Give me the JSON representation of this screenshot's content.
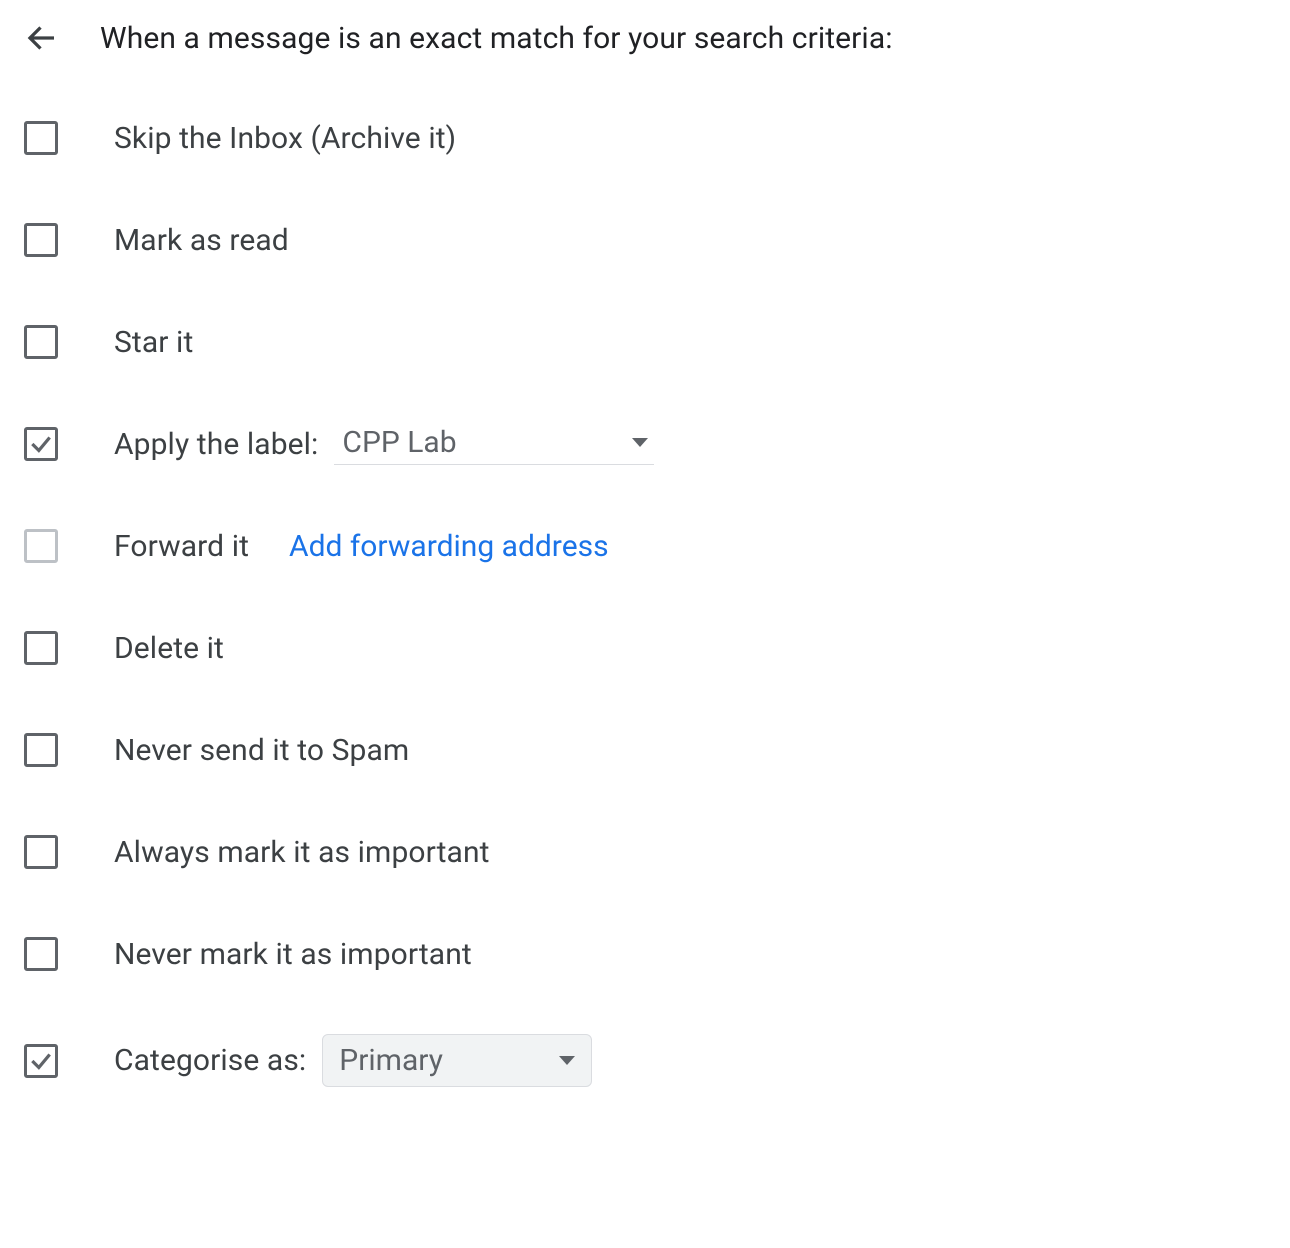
{
  "header": {
    "title": "When a message is an exact match for your search criteria:"
  },
  "options": {
    "skip_inbox": {
      "label": "Skip the Inbox (Archive it)",
      "checked": false
    },
    "mark_read": {
      "label": "Mark as read",
      "checked": false
    },
    "star": {
      "label": "Star it",
      "checked": false
    },
    "apply_label": {
      "label": "Apply the label:",
      "checked": true,
      "value": "CPP Lab"
    },
    "forward": {
      "label": "Forward it",
      "checked": false,
      "link": "Add forwarding address",
      "disabled": true
    },
    "delete": {
      "label": "Delete it",
      "checked": false
    },
    "never_spam": {
      "label": "Never send it to Spam",
      "checked": false
    },
    "always_important": {
      "label": "Always mark it as important",
      "checked": false
    },
    "never_important": {
      "label": "Never mark it as important",
      "checked": false
    },
    "categorise": {
      "label": "Categorise as:",
      "checked": true,
      "value": "Primary"
    }
  }
}
